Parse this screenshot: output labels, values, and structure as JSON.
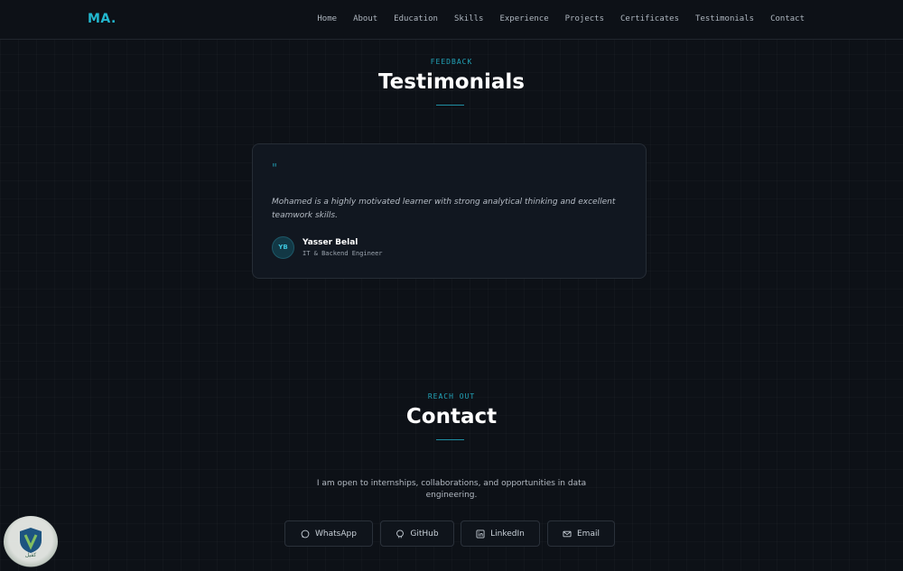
{
  "nav": {
    "logo": "MA.",
    "items": [
      "Home",
      "About",
      "Education",
      "Skills",
      "Experience",
      "Projects",
      "Certificates",
      "Testimonials",
      "Contact"
    ]
  },
  "testimonials": {
    "eyebrow": "FEEDBACK",
    "title": "Testimonials",
    "quote_mark": "\"",
    "quote": "Mohamed is a highly motivated learner with strong analytical thinking and excellent teamwork skills.",
    "author_initials": "YB",
    "author_name": "Yasser Belal",
    "author_role": "IT & Backend Engineer"
  },
  "contact": {
    "eyebrow": "REACH OUT",
    "title": "Contact",
    "description": "I am open to internships, collaborations, and opportunities in data engineering.",
    "buttons": {
      "whatsapp": "WhatsApp",
      "github": "GitHub",
      "linkedin": "LinkedIn",
      "email": "Email"
    }
  },
  "badge": {
    "label": "كفيل"
  },
  "colors": {
    "accent": "#22b8cf",
    "background": "#0d1117",
    "card": "#111720"
  }
}
